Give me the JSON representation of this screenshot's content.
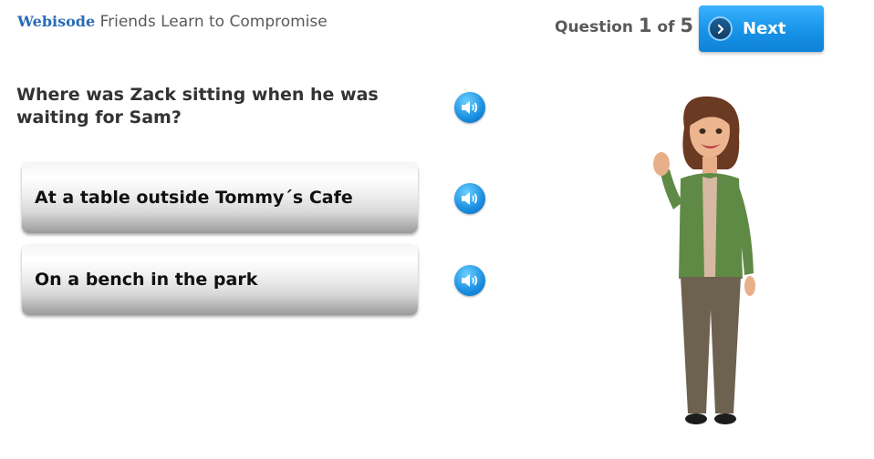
{
  "header": {
    "brand": "Webisode",
    "title": "Friends Learn to Compromise"
  },
  "counter": {
    "prefix": "Question",
    "current": "1",
    "separator": "of",
    "total": "5"
  },
  "next_button": {
    "label": "Next"
  },
  "question": {
    "text": "Where was Zack sitting when he was waiting for Sam?"
  },
  "answers": [
    {
      "text": "At a table outside Tommy´s Cafe"
    },
    {
      "text": "On a bench in the park"
    }
  ],
  "colors": {
    "brand": "#2a6cb5",
    "next_button": "#1793e8",
    "audio_icon": "#1a8ee0"
  },
  "icons": {
    "next": "chevron-right-icon",
    "audio": "speaker-icon"
  }
}
